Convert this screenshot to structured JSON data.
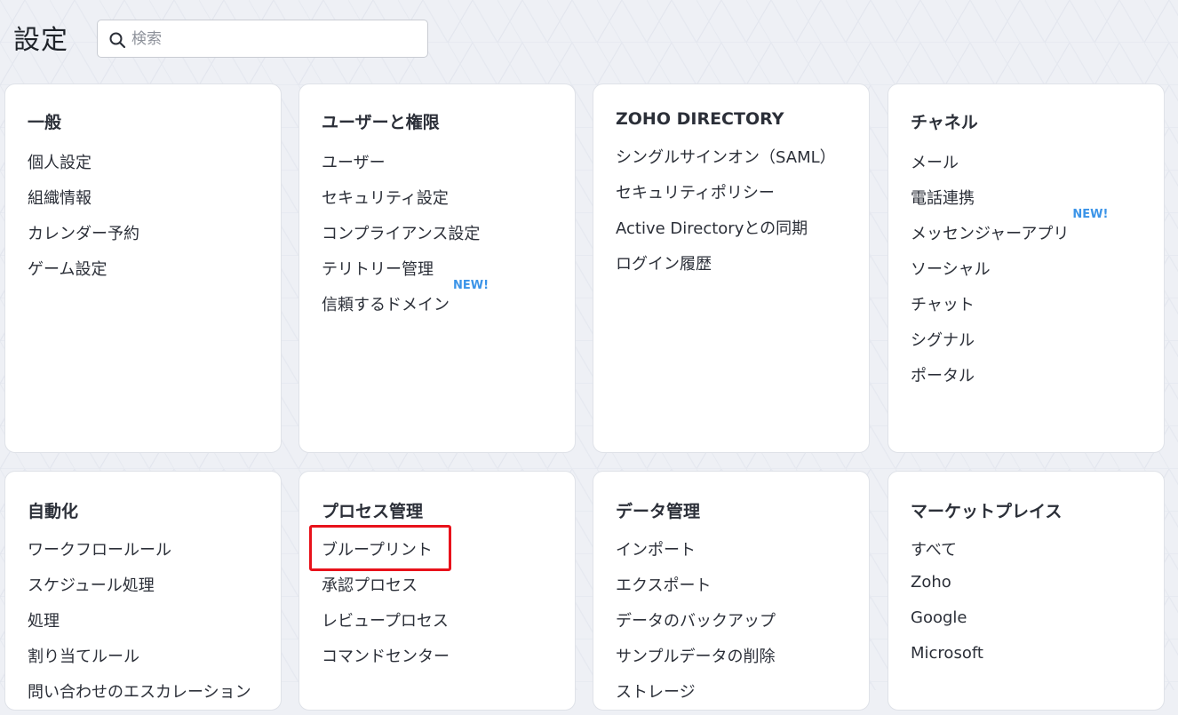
{
  "header": {
    "title": "設定",
    "search": {
      "placeholder": "検索",
      "value": ""
    }
  },
  "colors": {
    "accent_new": "#3b94e8",
    "highlight": "#e8121b",
    "background": "#eef0f5",
    "card": "#ffffff"
  },
  "cards": [
    {
      "title": "一般",
      "items": [
        {
          "label": "個人設定"
        },
        {
          "label": "組織情報"
        },
        {
          "label": "カレンダー予約"
        },
        {
          "label": "ゲーム設定"
        }
      ]
    },
    {
      "title": "ユーザーと権限",
      "items": [
        {
          "label": "ユーザー"
        },
        {
          "label": "セキュリティ設定"
        },
        {
          "label": "コンプライアンス設定"
        },
        {
          "label": "テリトリー管理"
        },
        {
          "label": "信頼するドメイン",
          "badge": "NEW!"
        }
      ]
    },
    {
      "title": "ZOHO DIRECTORY",
      "items": [
        {
          "label": "シングルサインオン（SAML）"
        },
        {
          "label": "セキュリティポリシー"
        },
        {
          "label": "Active Directoryとの同期"
        },
        {
          "label": "ログイン履歴"
        }
      ]
    },
    {
      "title": "チャネル",
      "items": [
        {
          "label": "メール"
        },
        {
          "label": "電話連携"
        },
        {
          "label": "メッセンジャーアプリ",
          "badge": "NEW!"
        },
        {
          "label": "ソーシャル"
        },
        {
          "label": "チャット"
        },
        {
          "label": "シグナル"
        },
        {
          "label": "ポータル"
        }
      ]
    },
    {
      "title": "自動化",
      "items": [
        {
          "label": "ワークフロールール"
        },
        {
          "label": "スケジュール処理"
        },
        {
          "label": "処理"
        },
        {
          "label": "割り当てルール"
        },
        {
          "label": "問い合わせのエスカレーション"
        }
      ]
    },
    {
      "title": "プロセス管理",
      "items": [
        {
          "label": "ブループリント"
        },
        {
          "label": "承認プロセス"
        },
        {
          "label": "レビュープロセス"
        },
        {
          "label": "コマンドセンター"
        }
      ]
    },
    {
      "title": "データ管理",
      "items": [
        {
          "label": "インポート"
        },
        {
          "label": "エクスポート"
        },
        {
          "label": "データのバックアップ"
        },
        {
          "label": "サンプルデータの削除"
        },
        {
          "label": "ストレージ"
        }
      ]
    },
    {
      "title": "マーケットプレイス",
      "items": [
        {
          "label": "すべて"
        },
        {
          "label": "Zoho"
        },
        {
          "label": "Google"
        },
        {
          "label": "Microsoft"
        }
      ]
    }
  ]
}
